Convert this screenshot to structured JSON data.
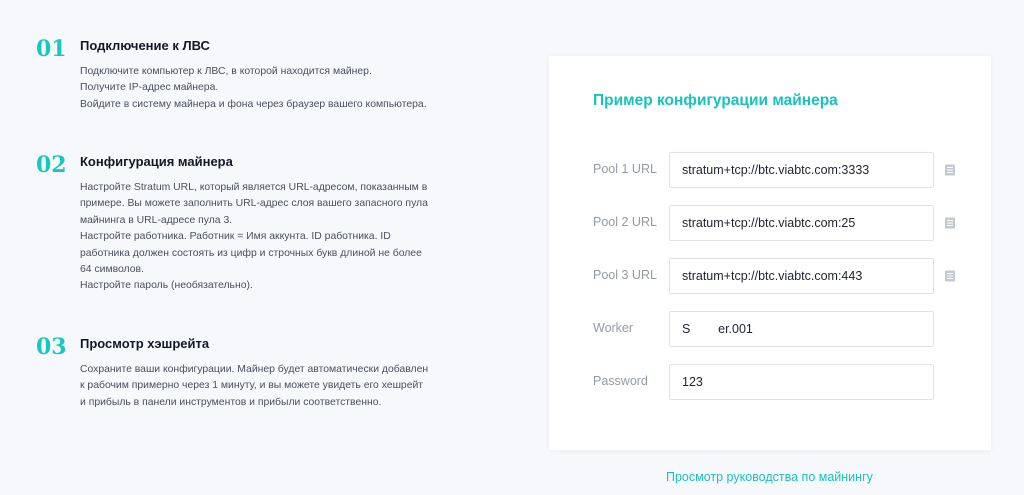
{
  "steps": [
    {
      "number": "01",
      "title": "Подключение к ЛВС",
      "lines": [
        "Подключите компьютер к ЛВС, в которой находится майнер.",
        "Получите IP-адрес майнера.",
        "Войдите в систему майнера и фона через браузер вашего компьютера."
      ]
    },
    {
      "number": "02",
      "title": "Конфигурация майнера",
      "lines": [
        "Настройте Stratum URL, который является URL-адресом, показанным в",
        "примере. Вы можете заполнить URL-адрес слоя вашего запасного пула",
        "майнинга в URL-адресе пула 3.",
        "Настройте работника. Работник = Имя аккунта. ID работника. ID",
        "работника должен состоять из цифр и строчных букв длиной не более",
        "64 символов.",
        "Настройте пароль (необязательно)."
      ]
    },
    {
      "number": "03",
      "title": "Просмотр хэшрейта",
      "lines": [
        "Сохраните ваши конфигурации. Майнер будет автоматически добавлен",
        "к рабочим примерно через 1 минуту, и вы можете увидеть его хешрейт",
        "и прибыль в панели инструментов и прибыли соответственно."
      ]
    }
  ],
  "config": {
    "title": "Пример конфигурации майнера",
    "fields": [
      {
        "label": "Pool 1 URL",
        "value": "stratum+tcp://btc.viabtc.com:3333",
        "copy_icon": "copy-icon"
      },
      {
        "label": "Pool 2 URL",
        "value": "stratum+tcp://btc.viabtc.com:25",
        "copy_icon": "copy-icon"
      },
      {
        "label": "Pool 3 URL",
        "value": "stratum+tcp://btc.viabtc.com:443",
        "copy_icon": "copy-icon"
      },
      {
        "label": "Worker",
        "value": "S        er.001"
      },
      {
        "label": "Password",
        "value": "123"
      }
    ]
  },
  "footer_link": "Просмотр руководства по майнингу",
  "colors": {
    "accent": "#17c3bc",
    "background": "#f7f8fb",
    "card": "#ffffff"
  }
}
